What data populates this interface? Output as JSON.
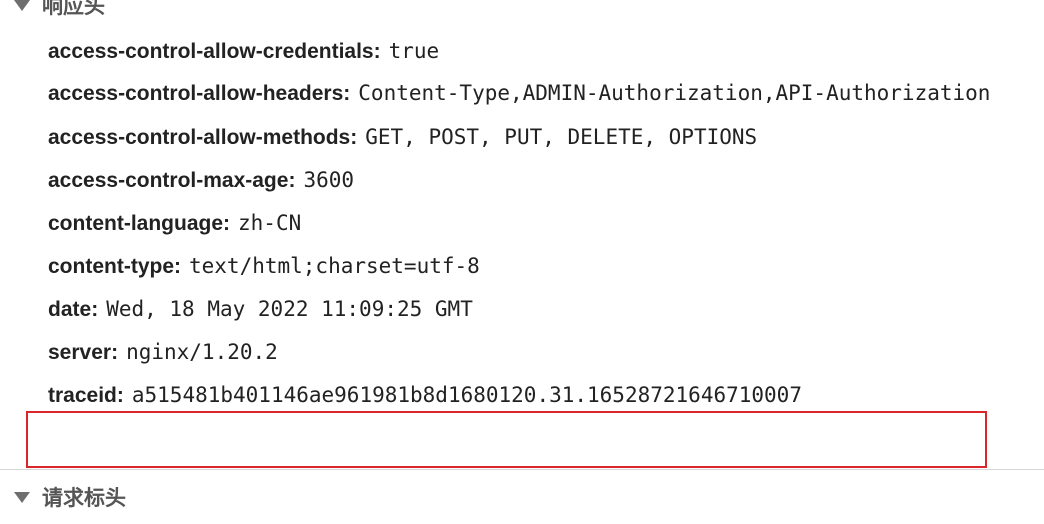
{
  "response_section": {
    "title": "响应头",
    "icon": "triangle-down-icon"
  },
  "response_headers": [
    {
      "name": "access-control-allow-credentials",
      "colon": ":",
      "value": "true"
    },
    {
      "name": "access-control-allow-headers",
      "colon": ":",
      "value": "Content-Type,ADMIN-Authorization,API-Authorization"
    },
    {
      "name": "access-control-allow-methods",
      "colon": ":",
      "value": "GET, POST, PUT, DELETE, OPTIONS"
    },
    {
      "name": "access-control-max-age",
      "colon": ":",
      "value": "3600"
    },
    {
      "name": "content-language",
      "colon": ":",
      "value": "zh-CN"
    },
    {
      "name": "content-type",
      "colon": ":",
      "value": "text/html;charset=utf-8"
    },
    {
      "name": "date",
      "colon": ":",
      "value": "Wed, 18 May 2022 11:09:25 GMT"
    },
    {
      "name": "server",
      "colon": ":",
      "value": "nginx/1.20.2"
    },
    {
      "name": "traceid",
      "colon": ":",
      "value": "a515481b401146ae961981b8d1680120.31.16528721646710007"
    }
  ],
  "request_section": {
    "title": "请求标头",
    "icon": "triangle-down-icon"
  },
  "colors": {
    "highlight_border": "#d8262a",
    "section_title": "#555555",
    "text": "#222222",
    "divider": "#d6d6d6"
  }
}
